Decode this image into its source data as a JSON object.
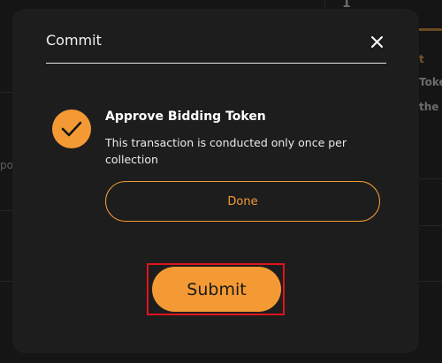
{
  "background": {
    "fragments": [
      "1",
      "t",
      "Toke",
      "the p",
      "po"
    ]
  },
  "modal": {
    "title": "Commit",
    "close_icon": "close-icon",
    "step": {
      "icon": "checkmark-icon",
      "title": "Approve Bidding Token",
      "description": "This transaction is conducted only once per collection",
      "done_label": "Done"
    },
    "submit_label": "Submit"
  },
  "colors": {
    "accent": "#f49a34",
    "modal_bg": "#1d1d1d",
    "highlight": "#e0141c"
  }
}
